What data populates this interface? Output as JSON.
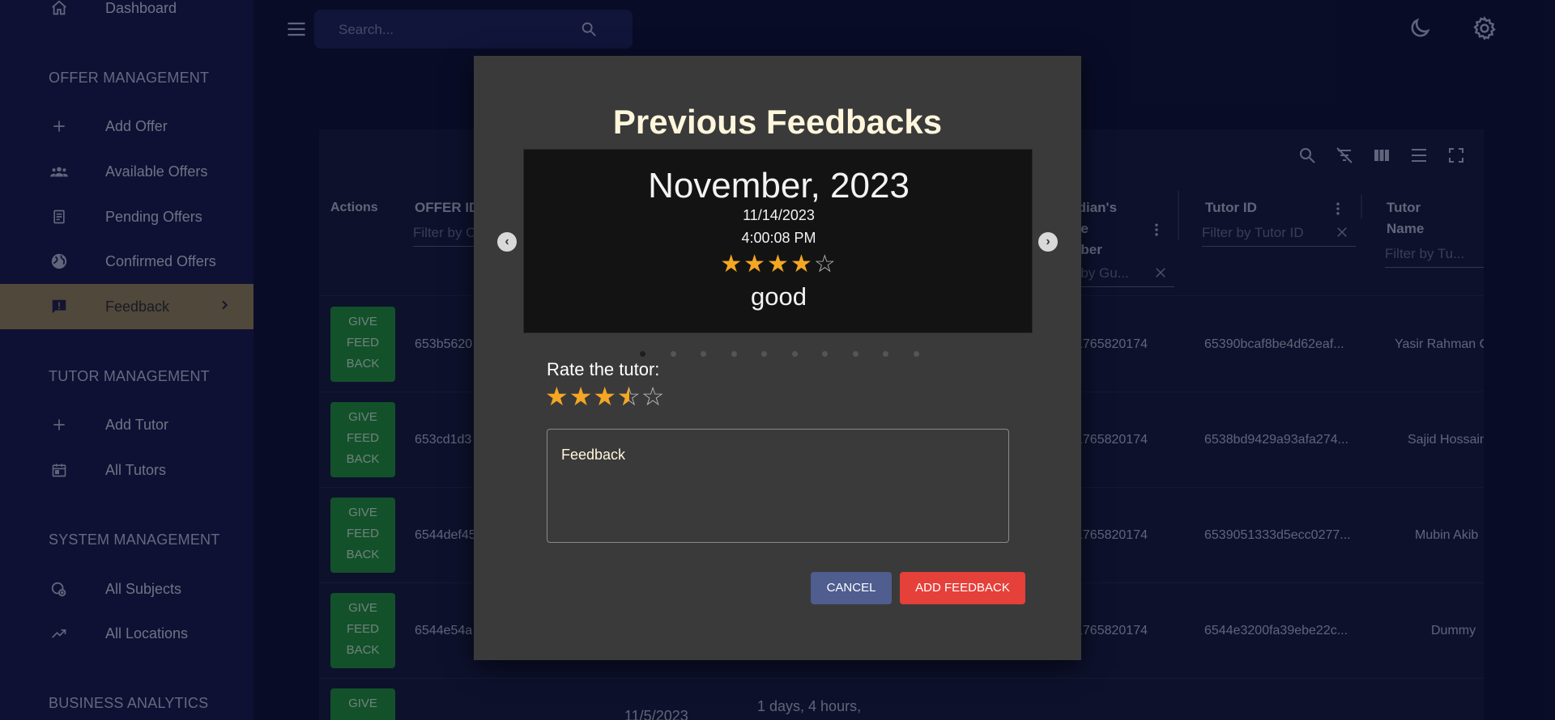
{
  "sidebar": {
    "dashboard": "Dashboard",
    "offer_management": "OFFER MANAGEMENT",
    "add_offer": "Add Offer",
    "available_offers": "Available Offers",
    "pending_offers": "Pending Offers",
    "confirmed_offers": "Confirmed Offers",
    "feedback": "Feedback",
    "tutor_management": "TUTOR MANAGEMENT",
    "add_tutor": "Add Tutor",
    "all_tutors": "All Tutors",
    "system_management": "SYSTEM MANAGEMENT",
    "all_subjects": "All Subjects",
    "all_locations": "All Locations",
    "business_analytics": "BUSINESS ANALYTICS"
  },
  "topbar": {
    "search_placeholder": "Search..."
  },
  "table": {
    "headers": {
      "actions": "Actions",
      "offer_id": "OFFER ID",
      "guardian_l1": "rdian's",
      "guardian_l2": "ne",
      "guardian_l3": "nber",
      "tutor_id": "Tutor ID",
      "tutor_name_l1": "Tutor",
      "tutor_name_l2": "Name"
    },
    "filters": {
      "offer_id": "Filter by O",
      "guardian": "r by Gu...",
      "tutor_id": "Filter by Tutor ID",
      "tutor_name": "Filter by Tu..."
    },
    "give_feedback": [
      "GIVE",
      "FEED",
      "BACK"
    ],
    "rows": [
      {
        "offer_id": "653b5620",
        "phone": "1765820174",
        "tutor_id": "65390bcaf8be4d62eaf...",
        "tutor_name": "Yasir Rahman C"
      },
      {
        "offer_id": "653cd1d3",
        "phone": "1765820174",
        "tutor_id": "6538bd9429a93afa274...",
        "tutor_name": "Sajid Hossain"
      },
      {
        "offer_id": "6544def45",
        "phone": "1765820174",
        "tutor_id": "6539051333d5ecc0277...",
        "tutor_name": "Mubin Akib"
      },
      {
        "offer_id": "6544e54a",
        "phone": "1765820174",
        "tutor_id": "6544e3200fa39ebe22c...",
        "tutor_name": "Dummy"
      }
    ],
    "last_row": {
      "date": "11/5/2023",
      "duration": "1 days, 4 hours,"
    }
  },
  "modal": {
    "title": "Previous Feedbacks",
    "card": {
      "month": "November, 2023",
      "date": "11/14/2023",
      "time": "4:00:08 PM",
      "rating": 4,
      "comment": "good"
    },
    "carousel_dots": 10,
    "carousel_active": 0,
    "rate_label": "Rate the tutor:",
    "rate_value": 3.5,
    "feedback_placeholder": "Feedback",
    "cancel": "CANCEL",
    "add": "ADD FEEDBACK"
  },
  "colors": {
    "accent_active": "#8f7f57",
    "give_button": "#1f8e3a",
    "add_button": "#e5403a",
    "cancel_button": "#4f5d8f",
    "star": "#f5a623"
  }
}
